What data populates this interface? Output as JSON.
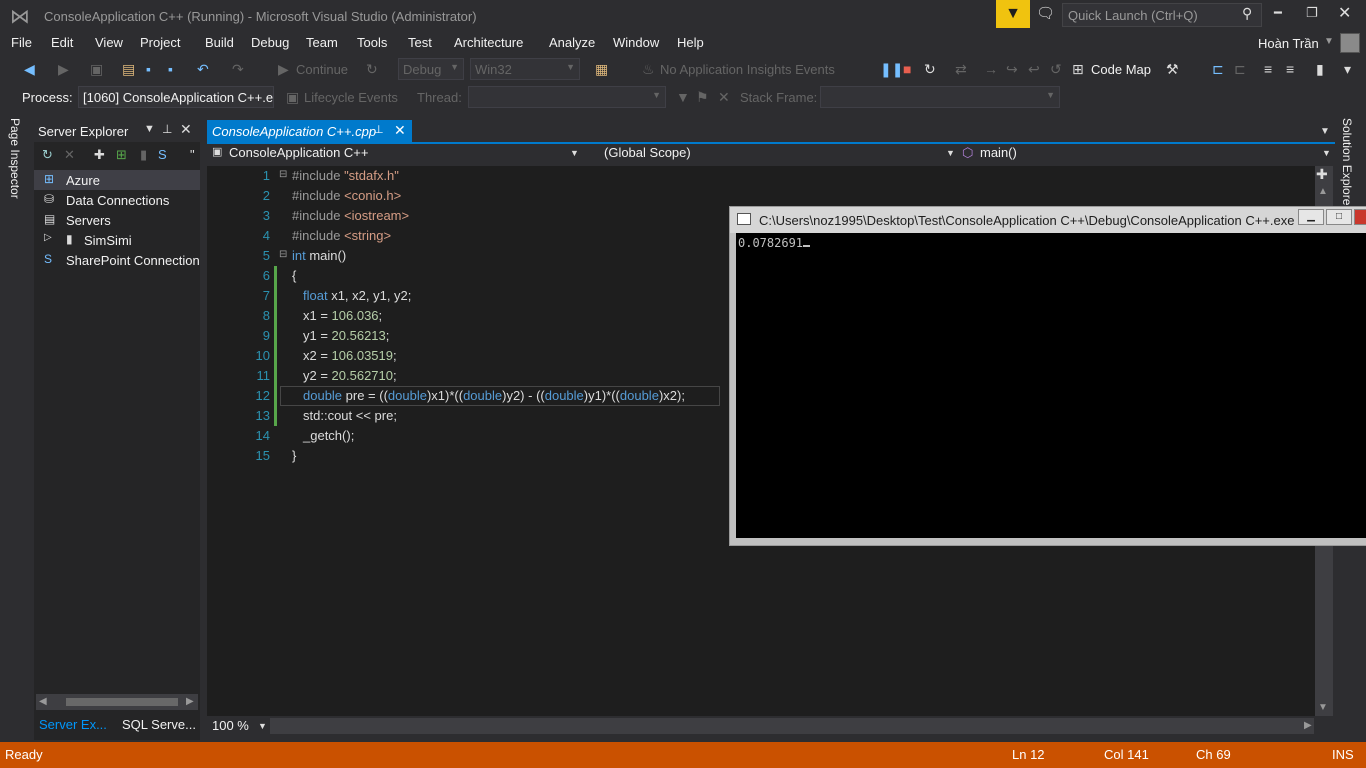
{
  "window": {
    "title": "ConsoleApplication C++ (Running) - Microsoft Visual Studio (Administrator)",
    "quick_launch_placeholder": "Quick Launch (Ctrl+Q)",
    "user_name": "Hoàn Trần"
  },
  "menu": [
    "File",
    "Edit",
    "View",
    "Project",
    "Build",
    "Debug",
    "Team",
    "Tools",
    "Test",
    "Architecture",
    "Analyze",
    "Window",
    "Help"
  ],
  "toolbar": {
    "continue_label": "Continue",
    "config_combo": "Debug",
    "platform_combo": "Win32",
    "insights_label": "No Application Insights Events",
    "codemap_label": "Code Map"
  },
  "debug_bar": {
    "process_label": "Process:",
    "process_value": "[1060] ConsoleApplication C++.e",
    "lifecycle_label": "Lifecycle Events",
    "thread_label": "Thread:",
    "stackframe_label": "Stack Frame:"
  },
  "left_sidebar": {
    "page_inspector": "Page Inspector"
  },
  "right_sidebar": {
    "solution_explorer": "Solution Explorer"
  },
  "server_explorer": {
    "title": "Server Explorer",
    "items": [
      {
        "label": "Azure"
      },
      {
        "label": "Data Connections"
      },
      {
        "label": "Servers"
      },
      {
        "label": "SimSimi"
      },
      {
        "label": "SharePoint Connections"
      }
    ],
    "tab_server": "Server Ex...",
    "tab_sql": "SQL Serve..."
  },
  "editor": {
    "tab_label": "ConsoleApplication C++.cpp",
    "nav_project": "ConsoleApplication C++",
    "nav_scope": "(Global Scope)",
    "nav_member": "main()",
    "zoom": "100 %",
    "lines": [
      "1",
      "2",
      "3",
      "4",
      "5",
      "6",
      "7",
      "8",
      "9",
      "10",
      "11",
      "12",
      "13",
      "14",
      "15"
    ],
    "code": {
      "l1_pp": "#include",
      "l1_str": "\"stdafx.h\"",
      "l2_pp": "#include",
      "l2_str": "<conio.h>",
      "l3_pp": "#include",
      "l3_str": "<iostream>",
      "l4_pp": "#include",
      "l4_str": "<string>",
      "l5_kw": "int",
      "l5_rest": " main()",
      "l6": "{",
      "l7_kw": "float",
      "l7_rest": " x1, x2, y1, y2;",
      "l8_a": "x1 = ",
      "l8_num": "106.036",
      "l8_b": ";",
      "l9_a": "y1 = ",
      "l9_num": "20.56213",
      "l9_b": ";",
      "l10_a": "x2 = ",
      "l10_num": "106.03519",
      "l10_b": ";",
      "l11_a": "y2 = ",
      "l11_num": "20.562710",
      "l11_b": ";",
      "l12_kw": "double",
      "l12_a": " pre = ((",
      "l12_kw2": "double",
      "l12_b": ")x1)*((",
      "l12_kw3": "double",
      "l12_c": ")y2) - ((",
      "l12_kw4": "double",
      "l12_d": ")y1)*((",
      "l12_kw5": "double",
      "l12_e": ")x2);",
      "l13": "std::cout << pre;",
      "l14": "_getch();",
      "l15": "}"
    }
  },
  "console": {
    "title": "C:\\Users\\noz1995\\Desktop\\Test\\ConsoleApplication C++\\Debug\\ConsoleApplication C++.exe",
    "output": "0.0782691"
  },
  "statusbar": {
    "state": "Ready",
    "line": "Ln 12",
    "col": "Col 141",
    "ch": "Ch 69",
    "mode": "INS"
  },
  "colors": {
    "accent": "#007acc",
    "status_debug": "#ca5100",
    "notification": "#f0c30f"
  }
}
